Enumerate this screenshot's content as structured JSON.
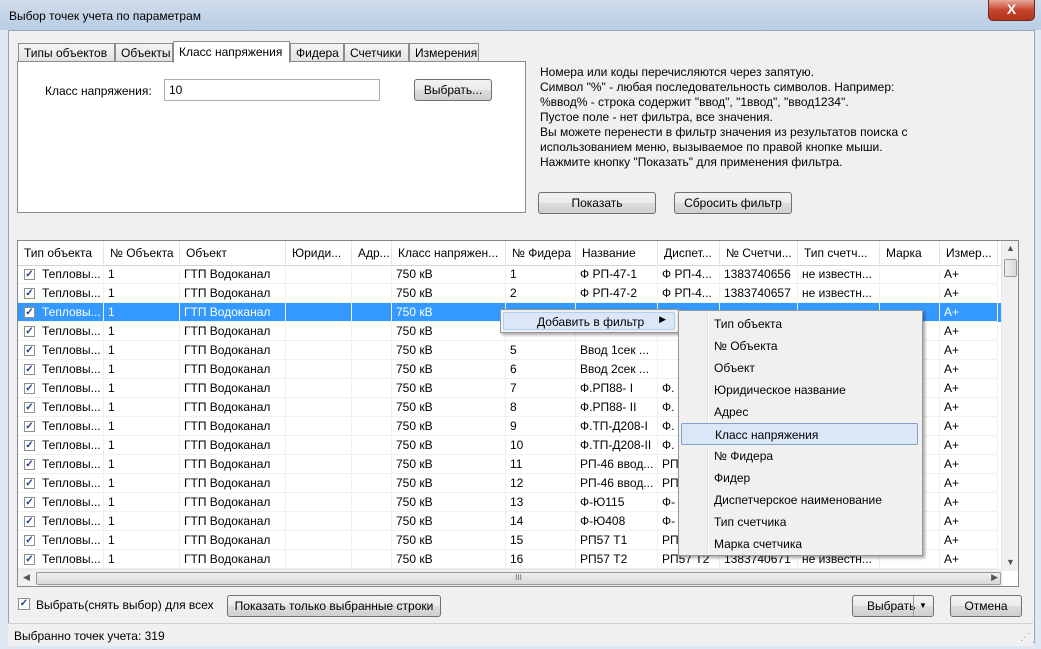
{
  "window": {
    "title": "Выбор точек учета по параметрам",
    "close_glyph": "X"
  },
  "tabs": [
    "Типы объектов",
    "Объекты",
    "Класс напряжения",
    "Фидера",
    "Счетчики",
    "Измерения"
  ],
  "filter": {
    "label": "Класс напряжения:",
    "value": "10",
    "choose_button": "Выбрать..."
  },
  "help_lines": [
    "Номера или коды перечисляются через запятую.",
    "Символ \"%\" - любая последовательность символов. Например:",
    "%ввод% - строка содержит \"ввод\", \"1ввод\", \"ввод1234\".",
    "Пустое поле - нет фильтра, все значения.",
    "Вы можете перенести в фильтр значения  из результатов поиска с",
    "использованием меню, вызываемое по правой кнопке мыши.",
    "Нажмите кнопку \"Показать\" для применения фильтра."
  ],
  "buttons": {
    "show": "Показать",
    "reset": "Сбросить фильтр",
    "show_selected": "Показать только выбранные строки",
    "select": "Выбрать",
    "cancel": "Отмена"
  },
  "grid": {
    "columns": [
      "Тип объекта",
      "№ Объекта",
      "Объект",
      "Юриди...",
      "Адр...",
      "Класс напряжен...",
      "№ Фидера",
      "Название",
      "Диспет...",
      "№ Счетчи...",
      "Тип счетч...",
      "Марка",
      "Измер..."
    ],
    "rows": [
      [
        "Тепловы...",
        "1",
        "ГТП Водоканал",
        "",
        "",
        "750 кВ",
        "1",
        "Ф РП-47-1",
        "Ф РП-4...",
        "1383740656",
        "не известн...",
        "",
        "А+"
      ],
      [
        "Тепловы...",
        "1",
        "ГТП Водоканал",
        "",
        "",
        "750 кВ",
        "2",
        "Ф РП-47-2",
        "Ф РП-4...",
        "1383740657",
        "не известн...",
        "",
        "А+"
      ],
      [
        "Тепловы...",
        "1",
        "ГТП Водоканал",
        "",
        "",
        "750 кВ",
        "",
        "",
        "",
        "",
        "",
        "",
        "А+"
      ],
      [
        "Тепловы...",
        "1",
        "ГТП Водоканал",
        "",
        "",
        "750 кВ",
        "",
        "",
        "",
        "",
        "",
        "",
        "А+"
      ],
      [
        "Тепловы...",
        "1",
        "ГТП Водоканал",
        "",
        "",
        "750 кВ",
        "5",
        "Ввод 1сек ...",
        "",
        "",
        "",
        "",
        "А+"
      ],
      [
        "Тепловы...",
        "1",
        "ГТП Водоканал",
        "",
        "",
        "750 кВ",
        "6",
        "Ввод 2сек ...",
        "",
        "",
        "",
        "",
        "А+"
      ],
      [
        "Тепловы...",
        "1",
        "ГТП Водоканал",
        "",
        "",
        "750 кВ",
        "7",
        "Ф.РП88- I",
        "Ф.",
        "",
        "",
        "",
        "А+"
      ],
      [
        "Тепловы...",
        "1",
        "ГТП Водоканал",
        "",
        "",
        "750 кВ",
        "8",
        "Ф.РП88- II",
        "Ф.",
        "",
        "",
        "",
        "А+"
      ],
      [
        "Тепловы...",
        "1",
        "ГТП Водоканал",
        "",
        "",
        "750 кВ",
        "9",
        "Ф.ТП-Д208-I",
        "Ф.",
        "",
        "",
        "",
        "А+"
      ],
      [
        "Тепловы...",
        "1",
        "ГТП Водоканал",
        "",
        "",
        "750 кВ",
        "10",
        "Ф.ТП-Д208-II",
        "Ф.",
        "",
        "",
        "",
        "А+"
      ],
      [
        "Тепловы...",
        "1",
        "ГТП Водоканал",
        "",
        "",
        "750 кВ",
        "11",
        "РП-46 ввод...",
        "РП",
        "",
        "",
        "",
        "А+"
      ],
      [
        "Тепловы...",
        "1",
        "ГТП Водоканал",
        "",
        "",
        "750 кВ",
        "12",
        "РП-46 ввод...",
        "РП",
        "",
        "",
        "",
        "А+"
      ],
      [
        "Тепловы...",
        "1",
        "ГТП Водоканал",
        "",
        "",
        "750 кВ",
        "13",
        "Ф-Ю115",
        "Ф-",
        "",
        "",
        "",
        "А+"
      ],
      [
        "Тепловы...",
        "1",
        "ГТП Водоканал",
        "",
        "",
        "750 кВ",
        "14",
        "Ф-Ю408",
        "Ф-",
        "",
        "",
        "",
        "А+"
      ],
      [
        "Тепловы...",
        "1",
        "ГТП Водоканал",
        "",
        "",
        "750 кВ",
        "15",
        "РП57 Т1",
        "РП",
        "",
        "",
        "",
        "А+"
      ],
      [
        "Тепловы...",
        "1",
        "ГТП Водоканал",
        "",
        "",
        "750 кВ",
        "16",
        "РП57 Т2",
        "РП57 Т2",
        "1383740671",
        "не известн...",
        "",
        "А+"
      ]
    ],
    "checkmark": "✓",
    "hscroll_grip": "III"
  },
  "context_menu": {
    "item": "Добавить в фильтр",
    "arrow": "▶"
  },
  "submenu": [
    "Тип объекта",
    "№ Объекта",
    "Объект",
    "Юридическое название",
    "Адрес",
    "Класс напряжения",
    "№ Фидера",
    "Фидер",
    "Диспетчерское наименование",
    "Тип счетчика",
    "Марка счетчика"
  ],
  "select_all_label": "Выбрать(снять выбор) для всех",
  "status": "Выбранно точек учета: 319"
}
